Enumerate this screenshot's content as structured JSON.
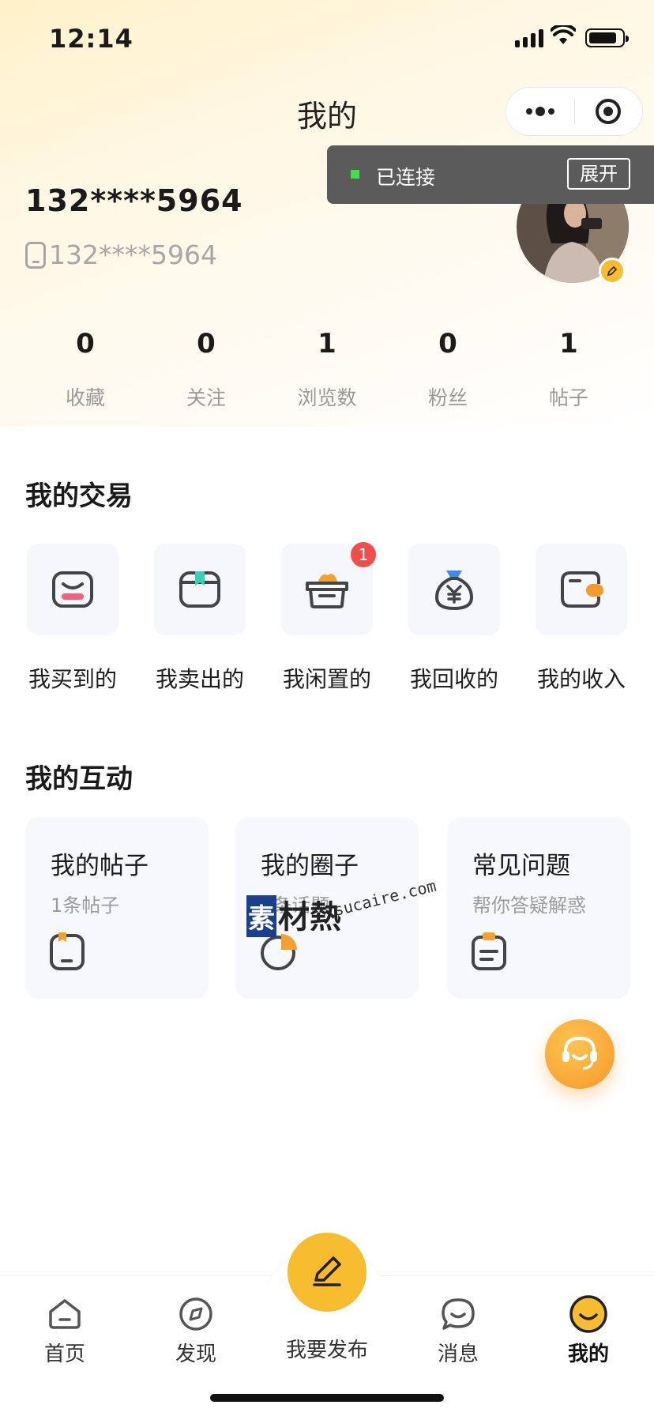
{
  "status_bar": {
    "time": "12:14"
  },
  "nav": {
    "title": "我的",
    "more_icon": "more-dots-icon",
    "close_icon": "target-icon"
  },
  "connection": {
    "status": "已连接",
    "expand_label": "展开",
    "dot_color": "#3fe04a"
  },
  "profile": {
    "name": "132****5964",
    "phone": "132****5964",
    "phone_icon": "phone-icon",
    "avatar_icon": "avatar-photo",
    "edit_icon": "pencil-icon"
  },
  "stats": [
    {
      "value": "0",
      "label": "收藏"
    },
    {
      "value": "0",
      "label": "关注"
    },
    {
      "value": "1",
      "label": "浏览数"
    },
    {
      "value": "0",
      "label": "粉丝"
    },
    {
      "value": "1",
      "label": "帖子"
    }
  ],
  "trade": {
    "title": "我的交易",
    "items": [
      {
        "label": "我买到的",
        "icon": "bag-face-icon",
        "badge": ""
      },
      {
        "label": "我卖出的",
        "icon": "box-bookmark-icon",
        "badge": ""
      },
      {
        "label": "我闲置的",
        "icon": "basket-icon",
        "badge": "1"
      },
      {
        "label": "我回收的",
        "icon": "money-bag-icon",
        "badge": ""
      },
      {
        "label": "我的收入",
        "icon": "wallet-icon",
        "badge": ""
      }
    ]
  },
  "interact": {
    "title": "我的互动",
    "cards": [
      {
        "title": "我的帖子",
        "subtitle": "1条帖子",
        "icon": "post-icon"
      },
      {
        "title": "我的圈子",
        "subtitle": "0条话题",
        "icon": "circle-pie-icon"
      },
      {
        "title": "常见问题",
        "subtitle": "帮你答疑解惑",
        "icon": "clipboard-icon"
      }
    ]
  },
  "watermark": {
    "brand_a": "素",
    "brand_b": "材熱",
    "url": "sucaire.com"
  },
  "customer_service": {
    "icon": "headset-icon"
  },
  "tabbar": {
    "items": [
      {
        "label": "首页",
        "icon": "home-icon"
      },
      {
        "label": "发现",
        "icon": "compass-icon"
      },
      {
        "label": "我要发布",
        "icon": "pencil-icon"
      },
      {
        "label": "消息",
        "icon": "chat-icon"
      },
      {
        "label": "我的",
        "icon": "smile-icon"
      }
    ],
    "active": "我的",
    "accent_color": "#f7bd2f"
  },
  "colors": {
    "accent": "#f7bd2f",
    "orange": "#f6982a",
    "badge_red": "#f24d4d",
    "teal": "#34d1b7"
  }
}
